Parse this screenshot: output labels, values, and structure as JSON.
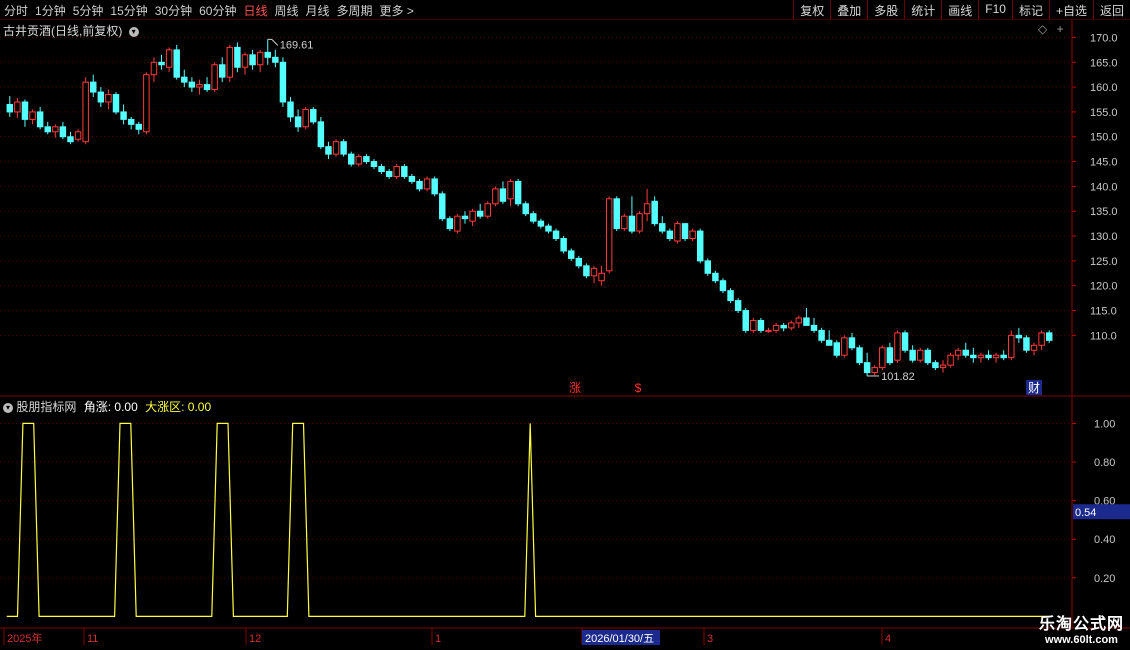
{
  "toolbar": {
    "tabs": [
      "分时",
      "1分钟",
      "5分钟",
      "15分钟",
      "30分钟",
      "60分钟",
      "日线",
      "周线",
      "月线",
      "多周期",
      "更多 >"
    ],
    "active_tab": 6,
    "buttons": [
      "复权",
      "叠加",
      "多股",
      "统计",
      "画线",
      "F10",
      "标记",
      "+自选",
      "返回"
    ]
  },
  "main_panel": {
    "title": "古井贡酒(日线,前复权)",
    "high_label": "169.61",
    "low_label": "101.82",
    "marks": [
      "涨",
      "$",
      "财"
    ]
  },
  "indicator_panel": {
    "title": "股朋指标网",
    "var1_label": "角涨",
    "var1_value": "0.00",
    "var2_label": "大涨区",
    "var2_value": "0.00",
    "current_value": "0.54"
  },
  "date_axis": {
    "labels": [
      "2025年",
      "11",
      "12",
      "1",
      "2026/01/30/五",
      "3",
      "4"
    ]
  },
  "watermark": {
    "line1": "乐淘公式网",
    "line2": "www.60lt.com"
  },
  "colors": {
    "up": "#ff3a3a",
    "down": "#54ffff",
    "indicator": "#ffff40",
    "grid": "#5a0000"
  },
  "chart_data": [
    {
      "type": "candlestick",
      "title": "古井贡酒(日线,前复权)",
      "y_ticks": [
        110.0,
        115.0,
        120.0,
        125.0,
        130.0,
        135.0,
        140.0,
        145.0,
        150.0,
        155.0,
        160.0,
        165.0,
        170.0
      ],
      "ylim": [
        100,
        171.5
      ],
      "high": 169.61,
      "low": 101.82,
      "ohlc": [
        [
          156.5,
          158.2,
          154.0,
          155.0
        ],
        [
          155.0,
          157.8,
          153.8,
          157.0
        ],
        [
          157.0,
          157.5,
          152.0,
          153.5
        ],
        [
          153.5,
          155.5,
          152.5,
          155.0
        ],
        [
          155.0,
          156.0,
          151.5,
          152.0
        ],
        [
          152.0,
          153.0,
          150.5,
          151.0
        ],
        [
          151.0,
          152.5,
          149.8,
          152.0
        ],
        [
          152.0,
          153.0,
          149.5,
          150.0
        ],
        [
          150.0,
          151.0,
          148.5,
          149.0
        ],
        [
          149.5,
          151.5,
          149.0,
          151.0
        ],
        [
          149.0,
          162.0,
          148.5,
          161.0
        ],
        [
          161.0,
          162.5,
          158.0,
          159.0
        ],
        [
          159.0,
          160.0,
          156.0,
          157.0
        ],
        [
          157.0,
          159.5,
          155.5,
          158.5
        ],
        [
          158.5,
          159.0,
          154.5,
          155.0
        ],
        [
          155.0,
          156.5,
          152.5,
          153.5
        ],
        [
          153.5,
          154.0,
          151.5,
          152.5
        ],
        [
          152.5,
          153.0,
          150.5,
          151.5
        ],
        [
          151.0,
          163.0,
          150.5,
          162.5
        ],
        [
          162.5,
          166.0,
          161.0,
          165.0
        ],
        [
          165.0,
          166.5,
          163.5,
          164.5
        ],
        [
          164.0,
          168.0,
          163.0,
          167.5
        ],
        [
          167.5,
          168.5,
          161.5,
          162.0
        ],
        [
          162.0,
          163.5,
          160.0,
          161.0
        ],
        [
          161.0,
          162.0,
          159.0,
          160.0
        ],
        [
          160.0,
          161.5,
          158.5,
          160.5
        ],
        [
          160.5,
          162.0,
          159.0,
          159.5
        ],
        [
          159.5,
          165.0,
          159.0,
          164.5
        ],
        [
          164.5,
          166.0,
          161.0,
          162.0
        ],
        [
          162.0,
          168.5,
          161.0,
          168.0
        ],
        [
          168.0,
          169.0,
          163.0,
          164.0
        ],
        [
          164.0,
          167.0,
          162.5,
          166.5
        ],
        [
          166.5,
          167.5,
          163.5,
          164.5
        ],
        [
          164.5,
          167.5,
          163.0,
          167.0
        ],
        [
          167.0,
          169.61,
          164.5,
          166.0
        ],
        [
          166.0,
          167.5,
          164.0,
          165.0
        ],
        [
          165.0,
          166.0,
          156.0,
          157.0
        ],
        [
          157.0,
          158.0,
          153.0,
          154.0
        ],
        [
          154.0,
          155.5,
          151.0,
          152.0
        ],
        [
          152.0,
          156.0,
          151.5,
          155.5
        ],
        [
          155.5,
          156.0,
          152.5,
          153.0
        ],
        [
          153.0,
          154.0,
          147.5,
          148.0
        ],
        [
          148.0,
          149.0,
          145.5,
          146.5
        ],
        [
          146.5,
          149.5,
          146.0,
          149.0
        ],
        [
          149.0,
          149.5,
          146.0,
          146.5
        ],
        [
          146.5,
          147.0,
          144.0,
          144.5
        ],
        [
          144.5,
          146.5,
          144.0,
          146.0
        ],
        [
          146.0,
          146.5,
          144.5,
          145.0
        ],
        [
          145.0,
          145.5,
          143.5,
          144.0
        ],
        [
          144.0,
          144.5,
          142.5,
          143.0
        ],
        [
          143.0,
          143.5,
          141.5,
          142.0
        ],
        [
          142.0,
          144.5,
          141.5,
          144.0
        ],
        [
          144.0,
          144.5,
          141.5,
          142.0
        ],
        [
          142.0,
          142.5,
          140.5,
          141.0
        ],
        [
          141.0,
          141.5,
          139.0,
          139.5
        ],
        [
          139.5,
          142.0,
          139.0,
          141.5
        ],
        [
          141.5,
          142.0,
          138.0,
          138.5
        ],
        [
          138.5,
          139.0,
          133.0,
          133.5
        ],
        [
          133.5,
          134.0,
          131.0,
          131.5
        ],
        [
          131.0,
          134.5,
          130.5,
          134.0
        ],
        [
          134.0,
          135.0,
          132.5,
          133.5
        ],
        [
          133.0,
          135.5,
          132.0,
          135.0
        ],
        [
          135.0,
          136.5,
          133.5,
          134.0
        ],
        [
          134.0,
          137.0,
          133.5,
          136.5
        ],
        [
          136.5,
          140.0,
          136.0,
          139.5
        ],
        [
          139.5,
          141.0,
          136.5,
          137.0
        ],
        [
          137.5,
          141.5,
          136.0,
          141.0
        ],
        [
          141.0,
          141.5,
          136.0,
          136.5
        ],
        [
          136.5,
          137.0,
          134.0,
          134.5
        ],
        [
          134.5,
          135.0,
          132.5,
          133.0
        ],
        [
          133.0,
          133.5,
          131.5,
          132.0
        ],
        [
          132.0,
          132.5,
          130.5,
          131.0
        ],
        [
          131.0,
          131.5,
          129.0,
          129.5
        ],
        [
          129.5,
          130.0,
          126.5,
          127.0
        ],
        [
          127.0,
          127.5,
          125.0,
          125.5
        ],
        [
          125.5,
          126.0,
          123.5,
          124.0
        ],
        [
          124.0,
          124.5,
          121.5,
          122.0
        ],
        [
          122.0,
          124.0,
          120.5,
          123.5
        ],
        [
          121.0,
          124.0,
          120.0,
          122.5
        ],
        [
          123.0,
          138.0,
          122.5,
          137.5
        ],
        [
          137.5,
          138.0,
          131.0,
          131.5
        ],
        [
          131.5,
          134.5,
          131.0,
          134.0
        ],
        [
          134.0,
          138.0,
          130.5,
          131.0
        ],
        [
          131.0,
          135.0,
          130.5,
          134.5
        ],
        [
          134.5,
          139.5,
          133.0,
          136.5
        ],
        [
          137.0,
          138.0,
          132.0,
          132.5
        ],
        [
          132.5,
          134.0,
          130.5,
          131.0
        ],
        [
          131.0,
          131.5,
          129.0,
          129.5
        ],
        [
          129.0,
          133.0,
          128.5,
          132.5
        ],
        [
          132.5,
          132.5,
          129.0,
          129.5
        ],
        [
          129.5,
          131.5,
          129.0,
          131.0
        ],
        [
          131.0,
          131.5,
          124.5,
          125.0
        ],
        [
          125.0,
          125.5,
          122.0,
          122.5
        ],
        [
          122.5,
          123.0,
          120.5,
          121.0
        ],
        [
          121.0,
          121.5,
          118.5,
          119.0
        ],
        [
          119.0,
          119.5,
          116.5,
          117.0
        ],
        [
          117.0,
          117.5,
          114.5,
          115.0
        ],
        [
          115.0,
          115.5,
          110.5,
          111.0
        ],
        [
          111.0,
          113.5,
          110.5,
          113.0
        ],
        [
          113.0,
          113.5,
          110.5,
          111.0
        ],
        [
          111.0,
          111.5,
          110.5,
          111.0
        ],
        [
          111.0,
          112.5,
          110.5,
          112.0
        ],
        [
          112.0,
          112.5,
          110.8,
          111.5
        ],
        [
          111.5,
          113.0,
          111.0,
          112.5
        ],
        [
          112.5,
          114.0,
          111.5,
          113.5
        ],
        [
          113.5,
          115.5,
          112.5,
          112.0
        ],
        [
          112.0,
          113.5,
          110.5,
          111.0
        ],
        [
          111.0,
          111.5,
          108.5,
          109.0
        ],
        [
          109.0,
          111.0,
          108.0,
          108.0
        ],
        [
          108.5,
          109.0,
          105.5,
          106.0
        ],
        [
          106.0,
          110.0,
          105.5,
          109.5
        ],
        [
          109.5,
          110.5,
          107.0,
          107.5
        ],
        [
          107.5,
          108.0,
          104.0,
          104.5
        ],
        [
          104.5,
          106.5,
          101.82,
          102.5
        ],
        [
          102.5,
          104.0,
          102.0,
          103.5
        ],
        [
          103.5,
          108.0,
          103.0,
          107.5
        ],
        [
          107.5,
          108.5,
          104.0,
          104.5
        ],
        [
          105.0,
          111.0,
          104.5,
          110.5
        ],
        [
          110.5,
          111.0,
          106.5,
          107.0
        ],
        [
          107.0,
          108.0,
          104.5,
          105.0
        ],
        [
          105.0,
          107.5,
          104.5,
          107.0
        ],
        [
          107.0,
          107.5,
          104.0,
          104.5
        ],
        [
          104.5,
          105.0,
          103.0,
          103.5
        ],
        [
          103.5,
          105.0,
          102.5,
          104.0
        ],
        [
          104.0,
          106.5,
          103.5,
          106.0
        ],
        [
          106.0,
          107.5,
          105.0,
          107.0
        ],
        [
          107.0,
          108.5,
          105.5,
          106.0
        ],
        [
          106.0,
          107.5,
          104.5,
          105.5
        ],
        [
          105.5,
          106.5,
          104.5,
          106.0
        ],
        [
          106.0,
          107.0,
          105.0,
          105.5
        ],
        [
          105.5,
          106.5,
          104.5,
          106.0
        ],
        [
          106.0,
          107.0,
          105.0,
          105.5
        ],
        [
          105.5,
          111.0,
          105.0,
          110.0
        ],
        [
          110.0,
          111.5,
          108.5,
          109.5
        ],
        [
          109.5,
          110.0,
          106.5,
          107.0
        ],
        [
          107.0,
          108.5,
          106.0,
          108.0
        ],
        [
          108.0,
          111.0,
          107.0,
          110.5
        ],
        [
          110.5,
          111.0,
          108.5,
          109.0
        ]
      ]
    },
    {
      "type": "line",
      "title": "股朋指标网",
      "y_ticks": [
        0.2,
        0.4,
        0.6,
        0.8,
        1.0
      ],
      "ylim": [
        -0.06,
        1.08
      ],
      "series": [
        {
          "name": "角涨",
          "values": [
            0,
            0,
            0,
            1,
            1,
            1,
            0,
            0,
            0,
            0,
            0,
            0,
            0,
            0,
            0,
            0,
            0,
            0,
            0,
            0,
            0,
            1,
            1,
            1,
            0,
            0,
            0,
            0,
            0,
            0,
            0,
            0,
            0,
            0,
            0,
            0,
            0,
            0,
            0,
            1,
            1,
            1,
            0,
            0,
            0,
            0,
            0,
            0,
            0,
            0,
            0,
            0,
            0,
            1,
            1,
            1,
            0,
            0,
            0,
            0,
            0,
            0,
            0,
            0,
            0,
            0,
            0,
            0,
            0,
            0,
            0,
            0,
            0,
            0,
            0,
            0,
            0,
            0,
            0,
            0,
            0,
            0,
            0,
            0,
            0,
            0,
            0,
            0,
            0,
            0,
            0,
            0,
            0,
            0,
            0,
            0,
            0,
            1,
            0,
            0,
            0,
            0,
            0,
            0,
            0,
            0,
            0,
            0,
            0,
            0,
            0,
            0,
            0,
            0,
            0,
            0,
            0,
            0,
            0,
            0,
            0,
            0,
            0,
            0,
            0,
            0,
            0,
            0,
            0,
            0,
            0,
            0,
            0,
            0,
            0,
            0,
            0,
            0,
            0,
            0,
            0,
            0,
            0,
            0,
            0,
            0,
            0,
            0,
            0,
            0,
            0,
            0,
            0,
            0,
            0,
            0,
            0,
            0,
            0,
            0,
            0,
            0,
            0,
            0,
            0,
            0,
            0,
            0,
            0,
            0,
            0,
            0,
            0,
            0,
            0,
            0,
            0,
            0,
            0,
            0,
            0,
            0,
            0,
            0,
            0,
            0,
            0,
            0,
            0,
            0,
            0,
            0,
            0,
            0
          ]
        },
        {
          "name": "大涨区",
          "values": []
        }
      ]
    }
  ]
}
